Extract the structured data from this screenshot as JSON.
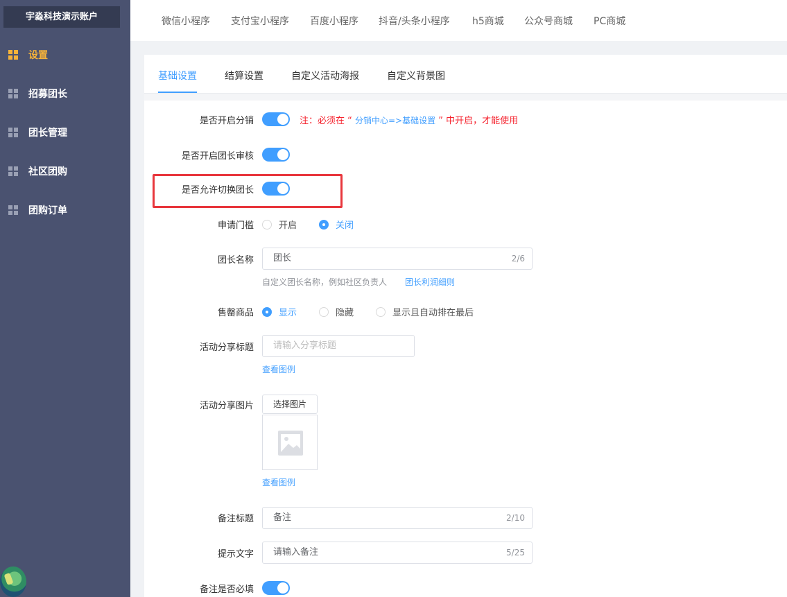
{
  "sidebar": {
    "account": "宇淼科技演示账户",
    "items": [
      {
        "label": "设置",
        "active": true
      },
      {
        "label": "招募团长",
        "active": false
      },
      {
        "label": "团长管理",
        "active": false
      },
      {
        "label": "社区团购",
        "active": false
      },
      {
        "label": "团购订单",
        "active": false
      }
    ]
  },
  "topbar": {
    "tabs": [
      "微信小程序",
      "支付宝小程序",
      "百度小程序",
      "抖音/头条小程序",
      "h5商城",
      "公众号商城",
      "PC商城"
    ]
  },
  "subtabs": {
    "items": [
      "基础设置",
      "结算设置",
      "自定义活动海报",
      "自定义背景图"
    ],
    "active": "基础设置"
  },
  "form": {
    "enable_distribution": {
      "label": "是否开启分销",
      "on": true,
      "note_prefix": "注：必须在 “ ",
      "note_path": "分销中心=>基础设置",
      "note_suffix": " ” 中开启，才能使用"
    },
    "enable_review": {
      "label": "是否开启团长审核",
      "on": true
    },
    "allow_switch": {
      "label": "是否允许切换团长",
      "on": true
    },
    "threshold": {
      "label": "申请门槛",
      "options": [
        "开启",
        "关闭"
      ],
      "selected": "关闭"
    },
    "leader_name": {
      "label": "团长名称",
      "value": "团长",
      "count": "2/6",
      "hint": "自定义团长名称，例如社区负责人",
      "link": "团长利润细则"
    },
    "sold_out": {
      "label": "售罄商品",
      "options": [
        "显示",
        "隐藏",
        "显示且自动排在最后"
      ],
      "selected": "显示"
    },
    "share_title": {
      "label": "活动分享标题",
      "placeholder": "请输入分享标题",
      "link": "查看图例"
    },
    "share_image": {
      "label": "活动分享图片",
      "button": "选择图片",
      "link": "查看图例"
    },
    "remark_title": {
      "label": "备注标题",
      "value": "备注",
      "count": "2/10"
    },
    "prompt_text": {
      "label": "提示文字",
      "value": "请输入备注",
      "count": "5/25"
    },
    "remark_required": {
      "label": "备注是否必填",
      "on": true
    }
  }
}
